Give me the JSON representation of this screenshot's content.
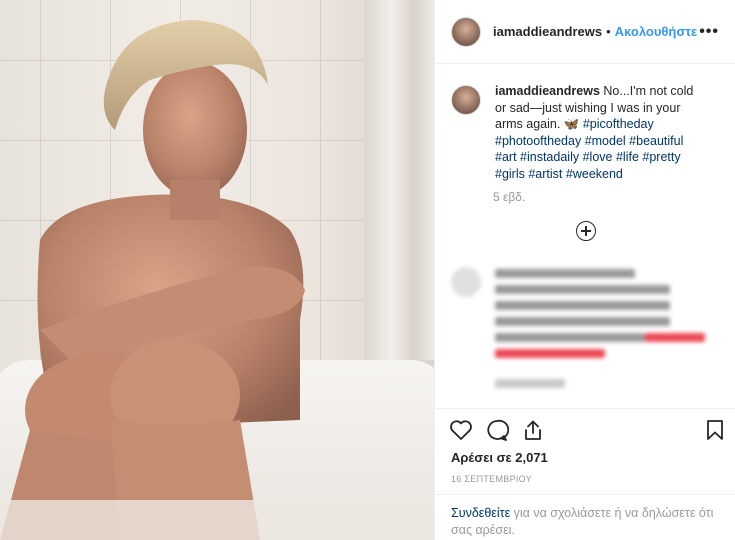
{
  "header": {
    "username": "iamaddieandrews",
    "separator": "•",
    "follow_label": "Ακολουθήστε",
    "more_icon": "more-horizontal-icon"
  },
  "caption": {
    "username": "iamaddieandrews",
    "text": "No...I'm not cold or sad—just wishing I was in your arms again.",
    "emoji": "🦋",
    "hashtags": [
      "#picoftheday",
      "#photooftheday",
      "#model",
      "#beautiful",
      "#art",
      "#instadaily",
      "#love",
      "#life",
      "#pretty",
      "#girls",
      "#artist",
      "#weekend"
    ],
    "time": "5 εβδ."
  },
  "load_more_icon": "plus-circle-icon",
  "actions": {
    "like_icon": "heart-icon",
    "comment_icon": "comment-icon",
    "share_icon": "share-icon",
    "save_icon": "bookmark-icon"
  },
  "likes_text": "Αρέσει σε 2,071",
  "date": "16 ΣΕΠΤΕΜΒΡΙΟΥ",
  "login": {
    "link": "Συνδεθείτε",
    "rest": " για να σχολιάσετε ή να δηλώσετε ότι σας αρέσει."
  },
  "colors": {
    "accent": "#3897f0",
    "hashtag": "#003569",
    "muted": "#999999",
    "text": "#262626"
  }
}
